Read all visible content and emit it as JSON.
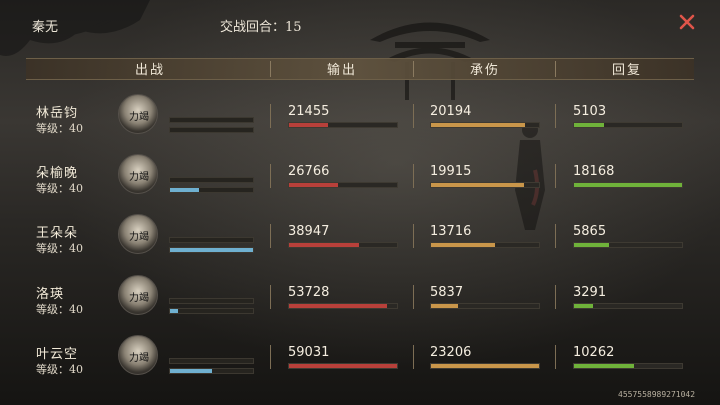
{
  "header": {
    "player_name": "秦无",
    "round_label": "交战回合：15"
  },
  "columns": {
    "fighter": "出战",
    "damage": "输出",
    "taken": "承伤",
    "heal": "回复"
  },
  "level_prefix": "等级：",
  "portrait_label": "力竭",
  "characters": [
    {
      "name": "林岳钧",
      "level": "等级：40",
      "bar1": 0.0,
      "bar2": 0.0,
      "damage": "21455",
      "damage_fill": 0.36,
      "taken": "20194",
      "taken_fill": 0.87,
      "heal": "5103",
      "heal_fill": 0.28
    },
    {
      "name": "朵榆晚",
      "level": "等级：40",
      "bar1": 0.0,
      "bar2": 0.35,
      "damage": "26766",
      "damage_fill": 0.45,
      "taken": "19915",
      "taken_fill": 0.86,
      "heal": "18168",
      "heal_fill": 1.0
    },
    {
      "name": "王朵朵",
      "level": "等级：40",
      "bar1": 0.0,
      "bar2": 1.0,
      "damage": "38947",
      "damage_fill": 0.65,
      "taken": "13716",
      "taken_fill": 0.59,
      "heal": "5865",
      "heal_fill": 0.32
    },
    {
      "name": "洛瑛",
      "level": "等级：40",
      "bar1": 0.0,
      "bar2": 0.1,
      "damage": "53728",
      "damage_fill": 0.91,
      "taken": "5837",
      "taken_fill": 0.25,
      "heal": "3291",
      "heal_fill": 0.18
    },
    {
      "name": "叶云空",
      "level": "等级：40",
      "bar1": 0.0,
      "bar2": 0.5,
      "damage": "59031",
      "damage_fill": 1.0,
      "taken": "23206",
      "taken_fill": 1.0,
      "heal": "10262",
      "heal_fill": 0.56
    }
  ],
  "footer_id": "4557558989271042",
  "colors": {
    "damage": "#b8403a",
    "taken": "#c9964a",
    "heal": "#6fb23a",
    "mini": "#6fb0d0",
    "close": "#e0554a"
  }
}
